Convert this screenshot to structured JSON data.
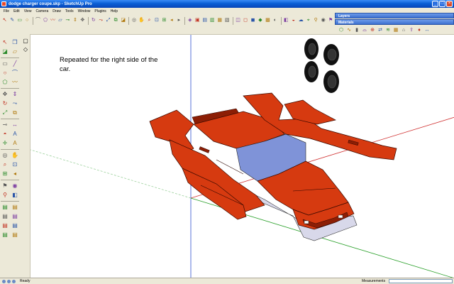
{
  "window": {
    "title": "dodge charger coupe.skp - SketchUp Pro",
    "controls": [
      "_",
      "□",
      "×"
    ]
  },
  "menu": [
    "File",
    "Edit",
    "View",
    "Camera",
    "Draw",
    "Tools",
    "Window",
    "Plugins",
    "Help"
  ],
  "tray": {
    "panels": [
      "Layers",
      "Materials"
    ]
  },
  "toolbar_icons": [
    "select-icon",
    "pencil-icon",
    "rectangle-icon",
    "circle-icon",
    "arc-icon",
    "polygon-icon",
    "freehand-icon",
    "eraser-icon",
    "tape-icon",
    "push-pull-icon",
    "move-icon",
    "rotate-icon",
    "follow-me-icon",
    "scale-icon",
    "offset-icon",
    "paint-icon",
    "orbit-icon",
    "pan-icon",
    "zoom-icon",
    "zoom-window-icon",
    "zoom-extents-icon",
    "previous-icon",
    "next-icon",
    "iso-icon",
    "top-icon",
    "front-icon",
    "right-icon",
    "back-icon",
    "left-icon",
    "xray-icon",
    "wireframe-icon",
    "hidden-line-icon",
    "shaded-icon",
    "textured-icon",
    "monochrome-icon",
    "section-icon",
    "shadow-icon",
    "fog-icon",
    "camera-icon",
    "walk-icon",
    "look-icon",
    "position-camera-icon"
  ],
  "toolbar2_icons": [
    "sandbox-icon",
    "smoove-icon",
    "stamp-icon",
    "drape-icon",
    "add-detail-icon",
    "flip-edge-icon",
    "from-contours-icon",
    "from-scratch-icon",
    "warehouse-icon",
    "share-icon",
    "ruby-icon",
    "dimension-icon"
  ],
  "palette_icons": [
    "select-icon",
    "component-icon",
    "paint-icon",
    "eraser-icon",
    "rectangle-icon",
    "line-icon",
    "circle-icon",
    "arc-icon",
    "polygon-icon",
    "freehand-icon",
    "move-icon",
    "push-pull-icon",
    "rotate-icon",
    "follow-me-icon",
    "scale-icon",
    "offset-icon",
    "tape-icon",
    "dimension-icon",
    "protractor-icon",
    "text-icon",
    "axes-icon",
    "3d-text-icon",
    "orbit-icon",
    "pan-icon",
    "zoom-icon",
    "zoom-window-icon",
    "zoom-extents-icon",
    "previous-icon",
    "position-camera-icon",
    "look-around-icon",
    "walk-icon",
    "section-plane-icon",
    "layer-a-icon",
    "layer-b-icon",
    "layer-c-icon",
    "layer-d-icon",
    "layer-e-icon",
    "layer-f-icon",
    "layer-g-icon",
    "layer-h-icon"
  ],
  "viewport": {
    "note": "Repeated for the right side of the car.",
    "colors": {
      "body": "#d63a10",
      "body_dark": "#8c1e05",
      "glass": "#7f93d8",
      "underside": "#d8d8ea",
      "tire": "#111111",
      "axis_red": "#d03030",
      "axis_green": "#2aa02a",
      "axis_blue": "#3050d0"
    }
  },
  "status": {
    "text": "Ready",
    "measurements_label": "Measurements"
  }
}
